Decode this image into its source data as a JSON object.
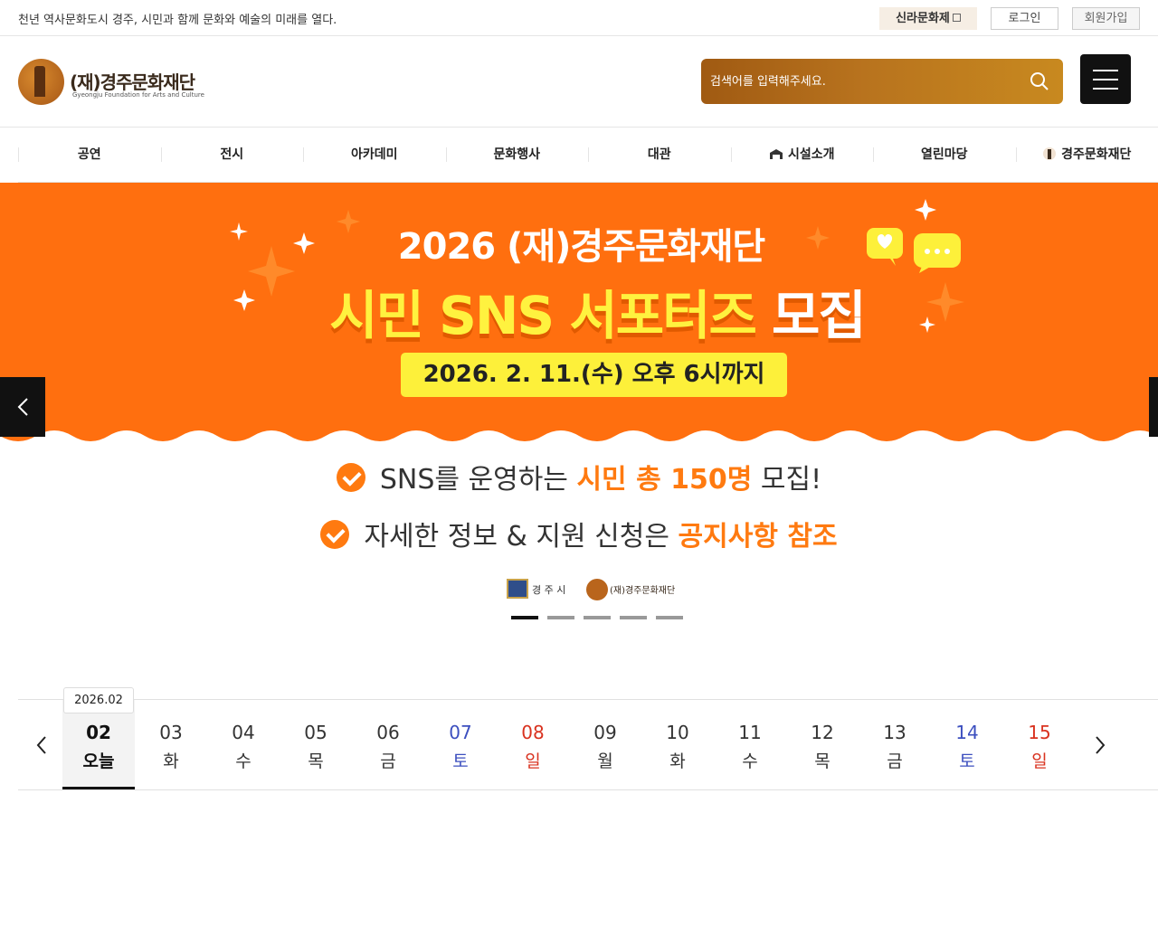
{
  "topbar": {
    "slogan": "천년 역사문화도시 경주, 시민과 함께 문화와 예술의 미래를 열다.",
    "silla_label": "신라문화제",
    "login_label": "로그인",
    "join_label": "회원가입"
  },
  "header": {
    "logo_text": "(재)경주문화재단",
    "logo_sub": "Gyeongju Foundation for Arts and Culture",
    "search_placeholder": "검색어를 입력해주세요.",
    "search_icon": "search-icon",
    "menu_icon": "hamburger-icon"
  },
  "gnb": {
    "items": [
      "공연",
      "전시",
      "아카데미",
      "문화행사",
      "대관",
      "시설소개",
      "열린마당",
      "경주문화재단"
    ]
  },
  "banner": {
    "year_line": "2026 (재)경주문화재단",
    "headline_part1": "시민 SNS 서포터즈",
    "headline_part2": "모집",
    "deadline": "2026. 2. 11.(수) 오후 6시까지",
    "bullet1_pre": "SNS를 운영하는",
    "bullet1_hl": "시민 총 150명",
    "bullet1_post": "모집!",
    "bullet2_pre": "자세한 정보 & 지원 신청은",
    "bullet2_hl": "공지사항 참조",
    "sponsor1": "경 주 시",
    "sponsor2": "(재)경주문화재단",
    "slide_count": 5,
    "active_slide": 1,
    "colors": {
      "orange": "#ff6f0f",
      "yellow": "#fff23f"
    }
  },
  "calendar": {
    "month": "2026.02",
    "days": [
      {
        "d": "02",
        "w": "오늘",
        "type": "today"
      },
      {
        "d": "03",
        "w": "화",
        "type": "weekday"
      },
      {
        "d": "04",
        "w": "수",
        "type": "weekday"
      },
      {
        "d": "05",
        "w": "목",
        "type": "weekday"
      },
      {
        "d": "06",
        "w": "금",
        "type": "weekday"
      },
      {
        "d": "07",
        "w": "토",
        "type": "sat"
      },
      {
        "d": "08",
        "w": "일",
        "type": "sun"
      },
      {
        "d": "09",
        "w": "월",
        "type": "weekday"
      },
      {
        "d": "10",
        "w": "화",
        "type": "weekday"
      },
      {
        "d": "11",
        "w": "수",
        "type": "weekday"
      },
      {
        "d": "12",
        "w": "목",
        "type": "weekday"
      },
      {
        "d": "13",
        "w": "금",
        "type": "weekday"
      },
      {
        "d": "14",
        "w": "토",
        "type": "sat"
      },
      {
        "d": "15",
        "w": "일",
        "type": "sun"
      }
    ]
  }
}
